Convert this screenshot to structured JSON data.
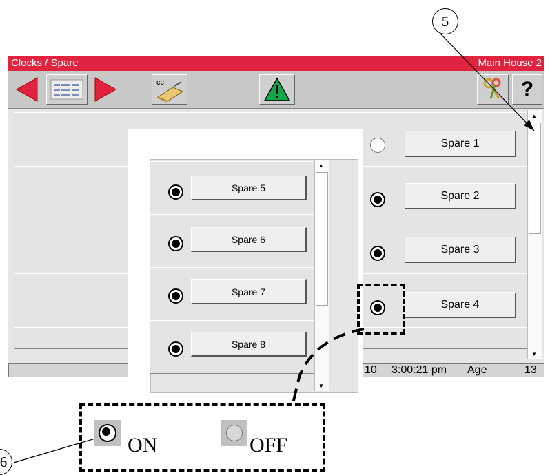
{
  "callouts": {
    "top_number": "5",
    "bottom_number": "6"
  },
  "window": {
    "title": "Clocks / Spare",
    "site": "Main House 2"
  },
  "toolbar": {
    "back_icon": "red-left-arrow",
    "list_icon": "list-card-icon",
    "forward_icon": "red-right-arrow",
    "cc_label": "cc",
    "warning_icon": "green-warning-triangle",
    "help_label": "?"
  },
  "spares": [
    {
      "label": "Spare 1",
      "state": "off"
    },
    {
      "label": "Spare 2",
      "state": "on"
    },
    {
      "label": "Spare 3",
      "state": "on"
    },
    {
      "label": "Spare 4",
      "state": "on"
    }
  ],
  "zoom_spares": [
    {
      "label": "Spare 5",
      "state": "on"
    },
    {
      "label": "Spare 6",
      "state": "on"
    },
    {
      "label": "Spare 7",
      "state": "on"
    },
    {
      "label": "Spare 8",
      "state": "on"
    }
  ],
  "status": {
    "date_fragment": "10",
    "time": "3:00:21 pm",
    "age_label": "Age",
    "age_value": "13"
  },
  "legend": {
    "on_label": "ON",
    "off_label": "OFF"
  },
  "colors": {
    "title_bar": "#e0243f",
    "nav_arrow": "#e0243f",
    "warning": "#12a84a"
  }
}
